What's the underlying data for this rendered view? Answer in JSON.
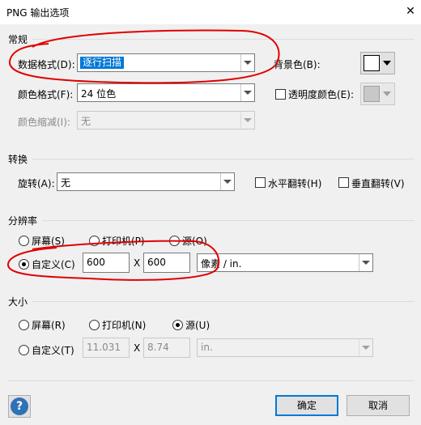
{
  "window": {
    "title": "PNG 输出选项",
    "close_glyph": "✕"
  },
  "general": {
    "heading": "常规",
    "data_format_label": "数据格式(D):",
    "data_format_value": "逐行扫描",
    "color_format_label": "颜色格式(F):",
    "color_format_value": "24 位色",
    "color_reduction_label": "颜色缩减(I):",
    "color_reduction_value": "无",
    "background_label": "背景色(B):",
    "background_color": "#ffffff",
    "transparency_label": "透明度颜色(E):",
    "transparency_color": "#c8c8c8"
  },
  "transform": {
    "heading": "转换",
    "rotation_label": "旋转(A):",
    "rotation_value": "无",
    "flip_h_label": "水平翻转(H)",
    "flip_v_label": "垂直翻转(V)"
  },
  "resolution": {
    "heading": "分辨率",
    "screen_label": "屏幕(S)",
    "printer_label": "打印机(P)",
    "source_label": "源(O)",
    "custom_label": "自定义(C)",
    "width_value": "600",
    "x_sep": "X",
    "height_value": "600",
    "unit_value": "像素 / in."
  },
  "size": {
    "heading": "大小",
    "screen_label": "屏幕(R)",
    "printer_label": "打印机(N)",
    "source_label": "源(U)",
    "custom_label": "自定义(T)",
    "width_value": "11.031",
    "x_sep": "X",
    "height_value": "8.74",
    "unit_value": "in."
  },
  "footer": {
    "help_glyph": "?",
    "ok_label": "确定",
    "cancel_label": "取消"
  },
  "icons": {
    "help": "help-icon",
    "dropdown": "chevron-down-icon",
    "close": "close-icon"
  },
  "colors": {
    "accent": "#0078d7",
    "annotation": "#e00000"
  }
}
